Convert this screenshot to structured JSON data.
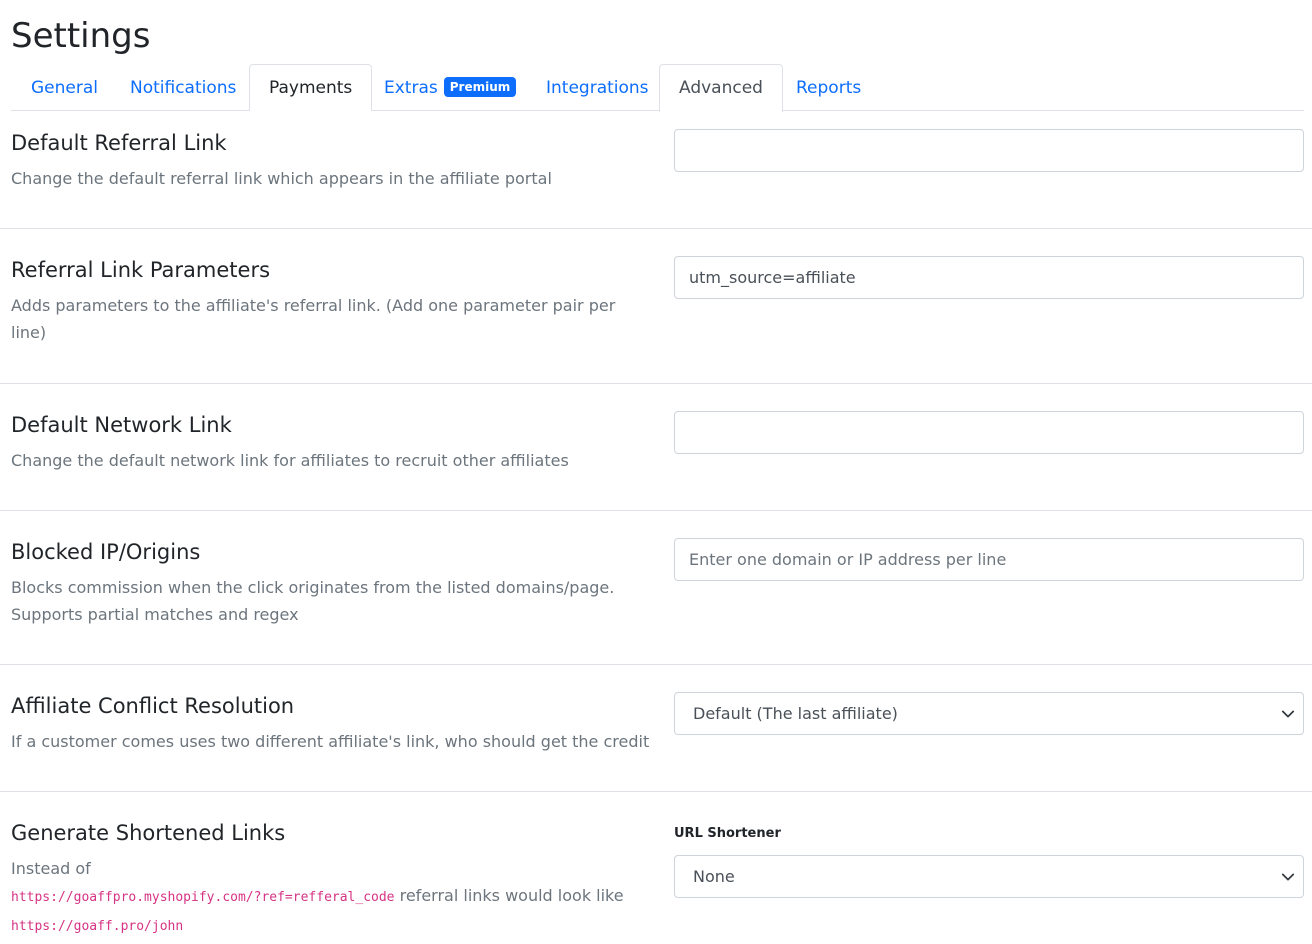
{
  "page": {
    "title": "Settings"
  },
  "tabs": [
    {
      "label": "General"
    },
    {
      "label": "Notifications"
    },
    {
      "label": "Payments"
    },
    {
      "label": "Extras",
      "badge": "Premium"
    },
    {
      "label": "Integrations"
    },
    {
      "label": "Advanced",
      "active": true
    },
    {
      "label": "Reports"
    }
  ],
  "sections": {
    "default_referral_link": {
      "title": "Default Referral Link",
      "description": "Change the default referral link which appears in the affiliate portal",
      "value": ""
    },
    "referral_link_parameters": {
      "title": "Referral Link Parameters",
      "description": "Adds parameters to the affiliate's referral link. (Add one parameter pair per line)",
      "value": "utm_source=affiliate"
    },
    "default_network_link": {
      "title": "Default Network Link",
      "description": "Change the default network link for affiliates to recruit other affiliates",
      "value": ""
    },
    "blocked_ip_origins": {
      "title": "Blocked IP/Origins",
      "description": "Blocks commission when the click originates from the listed domains/page. Supports partial matches and regex",
      "placeholder": "Enter one domain or IP address per line"
    },
    "affiliate_conflict_resolution": {
      "title": "Affiliate Conflict Resolution",
      "description": "If a customer comes uses two different affiliate's link, who should get the credit",
      "selected": "Default (The last affiliate)"
    },
    "generate_shortened_links": {
      "title": "Generate Shortened Links",
      "desc_prefix": "Instead of",
      "long_url": "https://goaffpro.myshopify.com/?ref=refferal_code",
      "desc_middle": "referral links would look like",
      "short_url": "https://goaff.pro/john",
      "field_label": "URL Shortener",
      "selected": "None"
    }
  },
  "colors": {
    "link": "#0d6efd",
    "badge": "#0d6efd",
    "code": "#d63384",
    "muted": "#6c757d",
    "border": "#dee2e6"
  }
}
